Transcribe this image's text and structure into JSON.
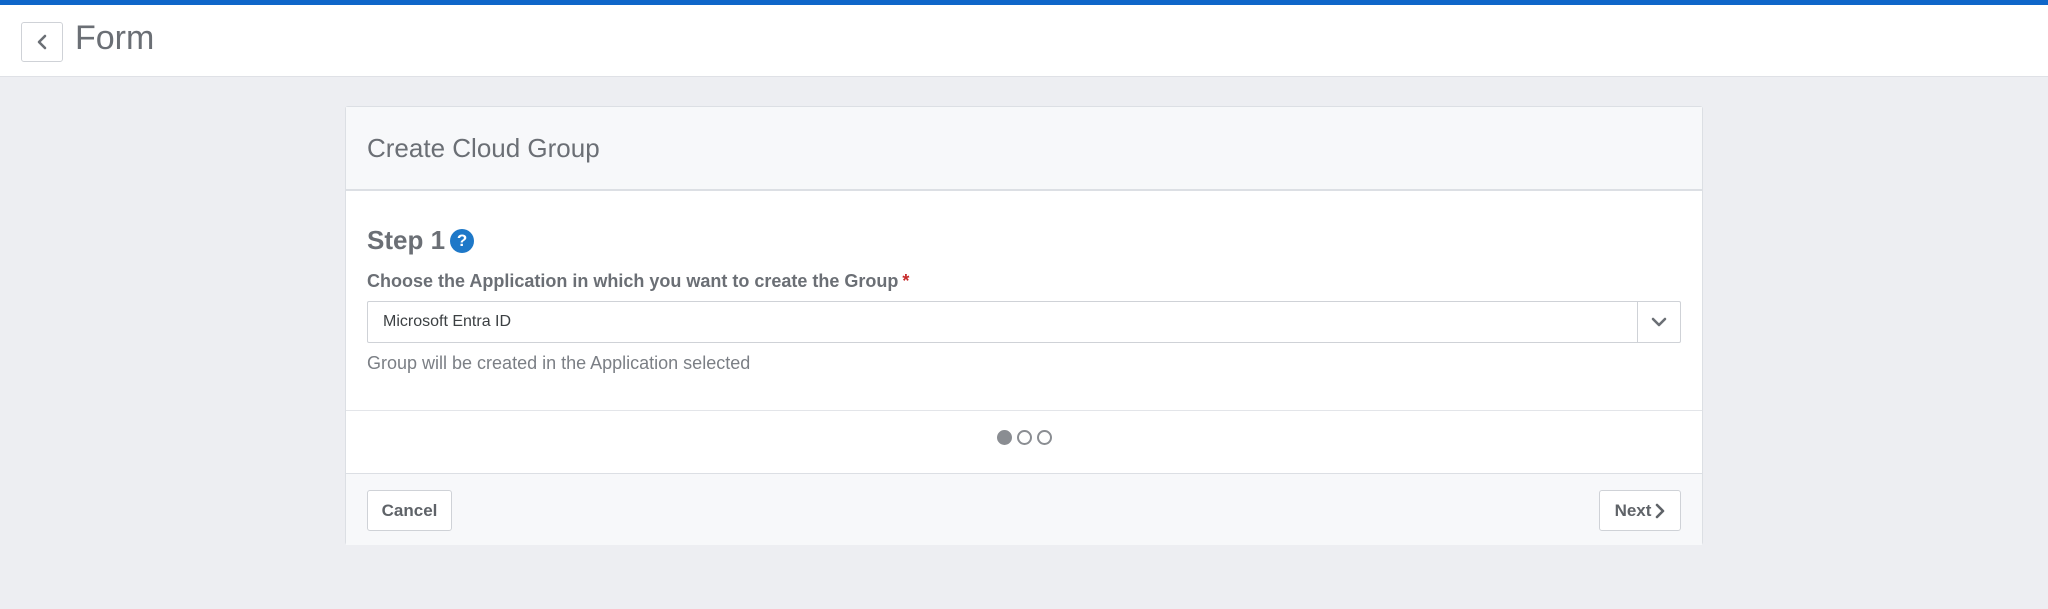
{
  "header": {
    "title": "Form",
    "back_icon": "chevron-left-icon",
    "accent_color": "#0f66c9"
  },
  "card": {
    "title": "Create Cloud Group",
    "step": {
      "title": "Step 1",
      "help_icon": "?"
    },
    "field": {
      "label": "Choose the Application in which you want to create the Group",
      "required_marker": "*",
      "value": "Microsoft Entra ID",
      "dropdown_icon": "chevron-down-icon",
      "help_text": "Group will be created in the Application selected"
    },
    "progress": {
      "current_step": 1,
      "total_steps": 3
    }
  },
  "footer": {
    "cancel_label": "Cancel",
    "next_label": "Next"
  }
}
